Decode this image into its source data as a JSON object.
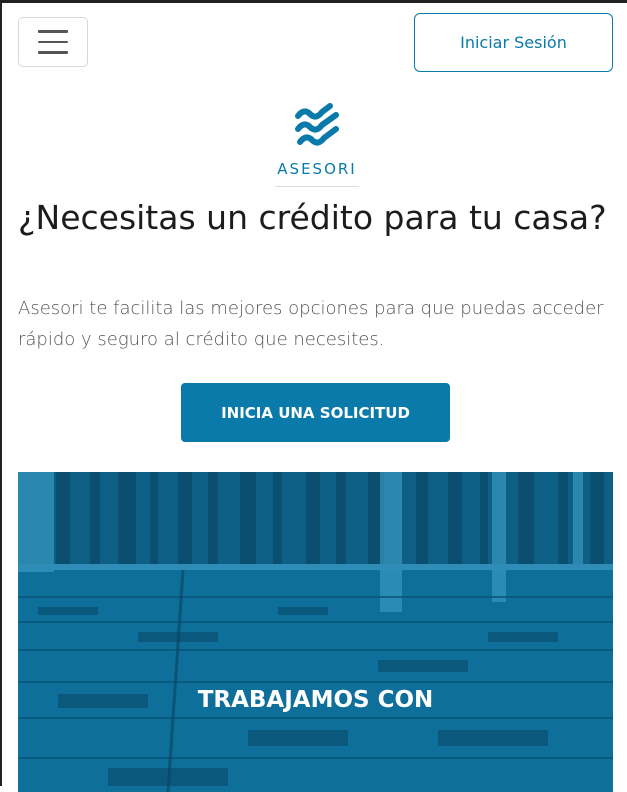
{
  "header": {
    "menu_icon": "hamburger-menu-icon",
    "login_label": "Iniciar Sesión"
  },
  "brand": {
    "logo_icon": "asesori-wave-logo",
    "name": "ASESORI",
    "color": "#0a7aaa"
  },
  "hero": {
    "title": "¿Necesitas un crédito para tu casa?",
    "subtitle": "Asesori te facilita las mejores opciones para que puedas acceder rápido y seguro al crédito que necesites.",
    "cta_label": "INICIA UNA SOLICITUD"
  },
  "banner": {
    "title": "TRABAJAMOS CON",
    "tint_color": "#0d6f99"
  }
}
